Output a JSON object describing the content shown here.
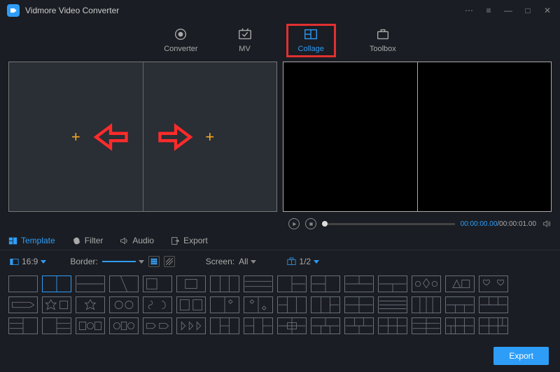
{
  "app": {
    "title": "Vidmore Video Converter"
  },
  "tabs": {
    "converter": "Converter",
    "mv": "MV",
    "collage": "Collage",
    "toolbox": "Toolbox"
  },
  "player": {
    "current": "00:00:00.00",
    "separator": "/",
    "total": "00:00:01.00"
  },
  "subtabs": {
    "template": "Template",
    "filter": "Filter",
    "audio": "Audio",
    "export": "Export"
  },
  "options": {
    "aspect": "16:9",
    "border_label": "Border:",
    "screen_label": "Screen:",
    "screen_value": "All",
    "page": "1/2"
  },
  "footer": {
    "export": "Export"
  }
}
